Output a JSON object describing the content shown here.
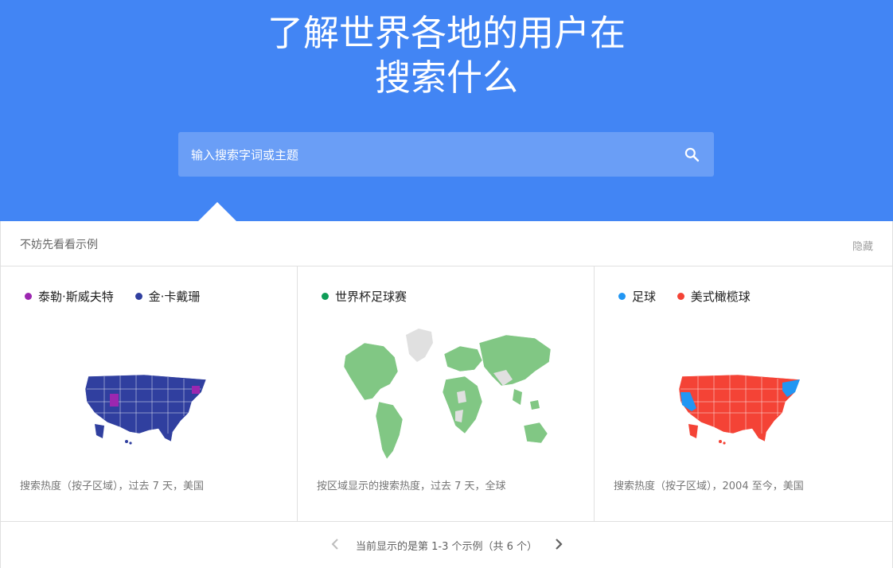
{
  "hero": {
    "title_line1": "了解世界各地的用户在",
    "title_line2": "搜索什么"
  },
  "search": {
    "placeholder": "输入搜索字词或主题",
    "icon": "search-icon"
  },
  "examples": {
    "header_label": "不妨先看看示例",
    "hide_label": "隐藏",
    "cards": [
      {
        "legend": [
          {
            "label": "泰勒·斯威夫特",
            "color": "#9c27b0"
          },
          {
            "label": "金·卡戴珊",
            "color": "#303f9f"
          }
        ],
        "caption": "搜索热度（按子区域），过去 7 天，美国"
      },
      {
        "legend": [
          {
            "label": "世界杯足球赛",
            "color": "#0f9d58"
          }
        ],
        "caption": "按区域显示的搜索热度，过去 7 天，全球"
      },
      {
        "legend": [
          {
            "label": "足球",
            "color": "#2196f3"
          },
          {
            "label": "美式橄榄球",
            "color": "#f44336"
          }
        ],
        "caption": "搜索热度（按子区域），2004 至今，美国"
      }
    ],
    "pager_text": "当前显示的是第 1-3 个示例（共 6 个）"
  },
  "colors": {
    "brand_blue": "#4285f4",
    "map_green": "#81c784",
    "map_gray": "#e0e0e0"
  }
}
